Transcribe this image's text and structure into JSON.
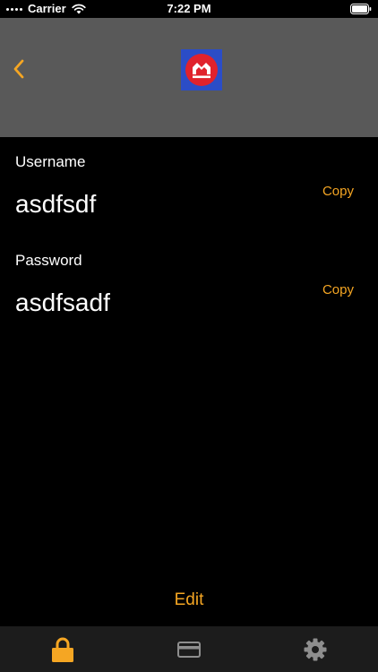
{
  "status_bar": {
    "carrier": "Carrier",
    "time": "7:22 PM"
  },
  "header": {
    "back_icon": "chevron-left-icon",
    "logo": "bank-logo"
  },
  "credentials": {
    "username": {
      "label": "Username",
      "value": "asdfsdf",
      "copy_label": "Copy"
    },
    "password": {
      "label": "Password",
      "value": "asdfsadf",
      "copy_label": "Copy"
    }
  },
  "edit_label": "Edit",
  "tab_bar": {
    "tabs": [
      {
        "icon": "lock-icon",
        "selected": true
      },
      {
        "icon": "card-icon",
        "selected": false
      },
      {
        "icon": "gear-icon",
        "selected": false
      }
    ]
  },
  "colors": {
    "accent": "#f5a623",
    "header_background": "#595959",
    "background": "#000000",
    "tab_bar_background": "#1c1c1c",
    "inactive_icon": "#8e8e8e",
    "logo_blue": "#2b4dc7",
    "logo_red": "#e0222c"
  }
}
